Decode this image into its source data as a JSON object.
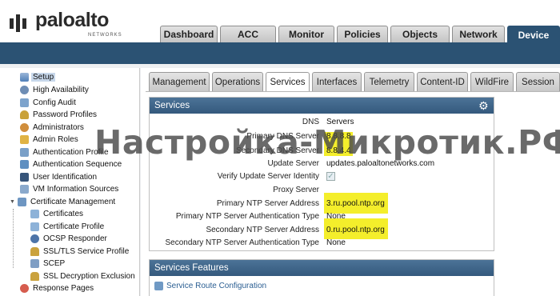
{
  "brand": {
    "name": "paloalto",
    "sub": "NETWORKS"
  },
  "top_tabs": [
    "Dashboard",
    "ACC",
    "Monitor",
    "Policies",
    "Objects",
    "Network",
    "Device"
  ],
  "active_top_tab": "Device",
  "sidebar": {
    "items": [
      {
        "label": "Setup",
        "icon": "setup-icon",
        "selected": true
      },
      {
        "label": "High Availability",
        "icon": "high-availability-icon"
      },
      {
        "label": "Config Audit",
        "icon": "config-audit-icon"
      },
      {
        "label": "Password Profiles",
        "icon": "key-icon"
      },
      {
        "label": "Administrators",
        "icon": "user-icon"
      },
      {
        "label": "Admin Roles",
        "icon": "roles-icon"
      },
      {
        "label": "Authentication Profile",
        "icon": "authentication-icon"
      },
      {
        "label": "Authentication Sequence",
        "icon": "sequence-icon"
      },
      {
        "label": "User Identification",
        "icon": "user-id-icon"
      },
      {
        "label": "VM Information Sources",
        "icon": "vm-icon"
      },
      {
        "label": "Certificate Management",
        "icon": "certificate-icon",
        "expanded": true
      },
      {
        "label": "Certificates",
        "icon": "certificate-icon",
        "child": true
      },
      {
        "label": "Certificate Profile",
        "icon": "certificate-icon",
        "child": true
      },
      {
        "label": "OCSP Responder",
        "icon": "ocsp-icon",
        "child": true
      },
      {
        "label": "SSL/TLS Service Profile",
        "icon": "lock-icon",
        "child": true
      },
      {
        "label": "SCEP",
        "icon": "scep-icon",
        "child": true
      },
      {
        "label": "SSL Decryption Exclusion",
        "icon": "lock-icon",
        "child": true
      },
      {
        "label": "Response Pages",
        "icon": "response-pages-icon"
      }
    ]
  },
  "sub_tabs": [
    "Management",
    "Operations",
    "Services",
    "Interfaces",
    "Telemetry",
    "Content-ID",
    "WildFire",
    "Session"
  ],
  "active_sub_tab": "Services",
  "services_panel": {
    "title": "Services",
    "rows": [
      {
        "label": "DNS",
        "value": "Servers"
      },
      {
        "label": "Primary DNS Server",
        "value": "8.8.8.8"
      },
      {
        "label": "Secondary DNS Server",
        "value": "8.8.4.4"
      },
      {
        "label": "Update Server",
        "value": "updates.paloaltonetworks.com"
      },
      {
        "label": "Verify Update Server Identity",
        "value": ""
      },
      {
        "label": "Proxy Server",
        "value": ""
      },
      {
        "label": "Primary NTP Server Address",
        "value": "3.ru.pool.ntp.org"
      },
      {
        "label": "Primary NTP Server Authentication Type",
        "value": "None"
      },
      {
        "label": "Secondary NTP Server Address",
        "value": "0.ru.pool.ntp.org"
      },
      {
        "label": "Secondary NTP Server Authentication Type",
        "value": "None"
      }
    ],
    "verify_update_checked": true
  },
  "features_panel": {
    "title": "Services Features",
    "link": "Service Route Configuration"
  },
  "watermark": "Настройка-Микротик.РФ",
  "colors": {
    "header_band": "#2b5273",
    "panel_head": "#3f6689",
    "highlight": "#f4ee2b",
    "link": "#2a5e92"
  }
}
